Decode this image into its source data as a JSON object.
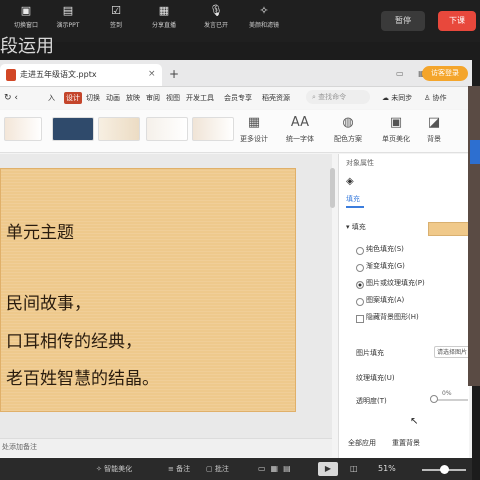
{
  "toolbar": {
    "items": [
      {
        "label": "切换窗口"
      },
      {
        "label": "演示PPT"
      },
      {
        "label": "签到"
      },
      {
        "label": "分享直播"
      },
      {
        "label": "发言已开"
      },
      {
        "label": "美颜和滤镜"
      }
    ],
    "pause_label": "暂停",
    "end_label": "下课"
  },
  "background_title": "段运用",
  "tab": {
    "file_name": "走进五年级语文.pptx",
    "close": "×",
    "add": "+",
    "login_label": "访客登录"
  },
  "menu": {
    "items": [
      "入",
      "设计",
      "切换",
      "动画",
      "放映",
      "审阅",
      "视图",
      "开发工具",
      "会员专享",
      "稻壳资源"
    ],
    "search_placeholder": "查找命令",
    "right_items": [
      "未同步",
      "协作"
    ]
  },
  "ribbon": {
    "more_design": "更多设计",
    "font_label": "统一字体",
    "color_label": "配色方案",
    "beautify_label": "单页美化",
    "background_label": "背景"
  },
  "slide": {
    "lines": [
      "单元主题",
      "民间故事，",
      "口耳相传的经典，",
      "老百姓智慧的结晶。"
    ]
  },
  "notes": {
    "placeholder": "处添加备注"
  },
  "panel": {
    "title": "对象属性",
    "fill_tab": "填充",
    "fill_section": "填充",
    "options": [
      "纯色填充(S)",
      "渐变填充(G)",
      "图片或纹理填充(P)",
      "图案填充(A)"
    ],
    "selected_index": 2,
    "hide_bg_label": "隐藏背景图形(H)",
    "picture_fill_label": "图片填充",
    "picture_fill_value": "请选择图片",
    "texture_fill_label": "纹理填充(U)",
    "transparency_label": "透明度(T)",
    "transparency_value": "0%",
    "apply_all": "全部应用",
    "reset_bg": "重置背景"
  },
  "status": {
    "smart_beautify": "智能美化",
    "notes": "备注",
    "review": "批注",
    "zoom": "51%",
    "play_icon": "▶"
  },
  "colors": {
    "accent": "#c4452b",
    "end_button": "#e8483c",
    "slide_bg": "#eec98c"
  }
}
